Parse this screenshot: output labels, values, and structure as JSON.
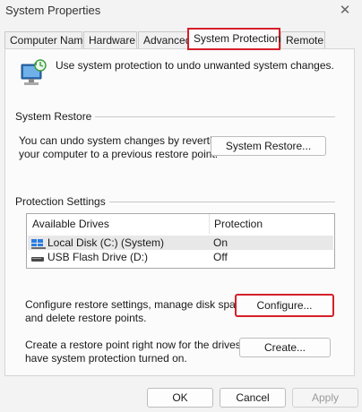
{
  "window": {
    "title": "System Properties",
    "close_glyph": "✕"
  },
  "tabs": [
    {
      "label": "Computer Name"
    },
    {
      "label": "Hardware"
    },
    {
      "label": "Advanced"
    },
    {
      "label": "System Protection",
      "active": true
    },
    {
      "label": "Remote"
    }
  ],
  "intro": {
    "text": "Use system protection to undo unwanted system changes.",
    "icon": "computer-shield-icon"
  },
  "system_restore": {
    "group_label": "System Restore",
    "description_line1": "You can undo system changes by reverting",
    "description_line2": "your computer to a previous restore point.",
    "button_label": "System Restore..."
  },
  "protection_settings": {
    "group_label": "Protection Settings",
    "columns": [
      "Available Drives",
      "Protection"
    ],
    "drives": [
      {
        "name": "Local Disk (C:) (System)",
        "protection": "On",
        "icon": "windows-drive-icon",
        "selected": true
      },
      {
        "name": "USB Flash Drive (D:)",
        "protection": "Off",
        "icon": "usb-drive-icon",
        "selected": false
      }
    ],
    "configure_text_line1": "Configure restore settings, manage disk space,",
    "configure_text_line2": "and delete restore points.",
    "configure_button": "Configure...",
    "create_text_line1": "Create a restore point right now for the drives that",
    "create_text_line2": "have system protection turned on.",
    "create_button": "Create..."
  },
  "footer": {
    "ok": "OK",
    "cancel": "Cancel",
    "apply": "Apply"
  },
  "colors": {
    "highlight": "#d4202a",
    "window_bg": "#f3f3f3"
  }
}
